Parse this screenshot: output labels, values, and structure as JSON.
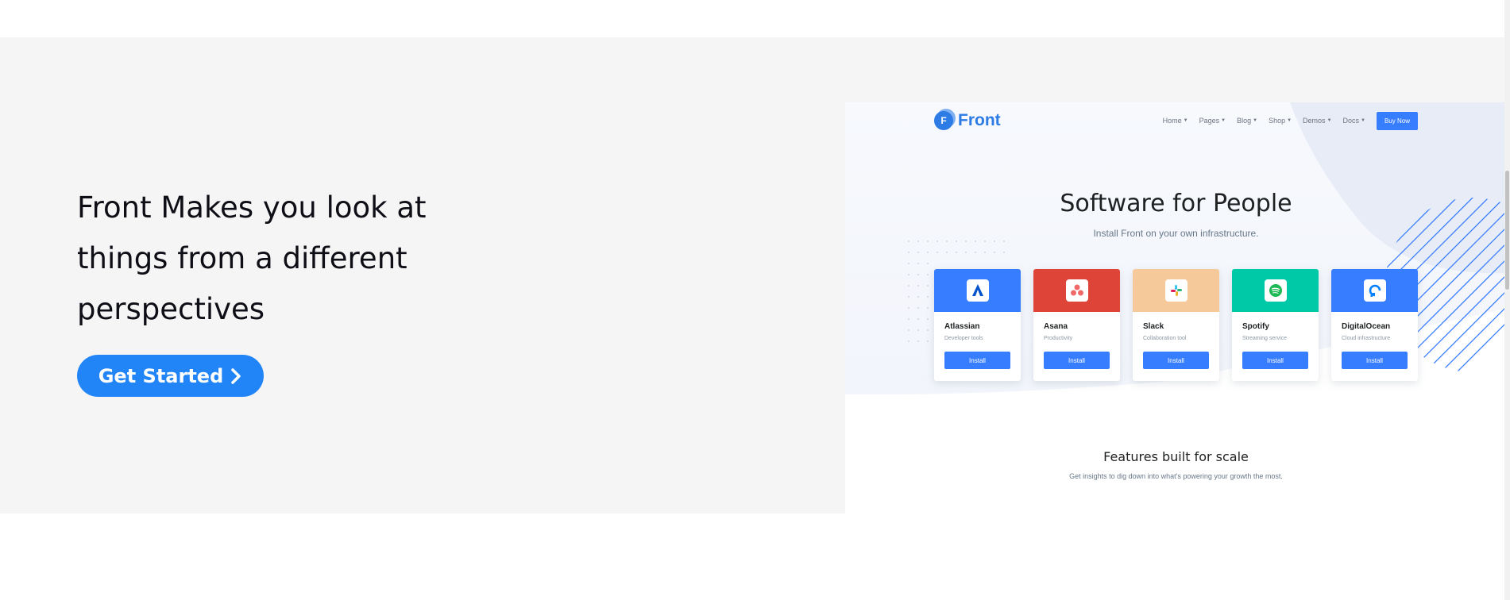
{
  "hero": {
    "title": "Front Makes you look at things from a different perspectives",
    "cta_label": "Get Started"
  },
  "preview": {
    "logo_text": "Front",
    "logo_letter": "F",
    "nav": [
      "Home",
      "Pages",
      "Blog",
      "Shop",
      "Demos",
      "Docs"
    ],
    "buy_label": "Buy Now",
    "title": "Software for People",
    "subtitle": "Install Front on your own infrastructure.",
    "cards": [
      {
        "name": "Atlassian",
        "category": "Developer tools",
        "button": "Install",
        "color": "#377dff",
        "icon": "atlassian-icon"
      },
      {
        "name": "Asana",
        "category": "Productivity",
        "button": "Install",
        "color": "#de4437",
        "icon": "asana-icon"
      },
      {
        "name": "Slack",
        "category": "Collaboration tool",
        "button": "Install",
        "color": "#f6c99a",
        "icon": "slack-icon"
      },
      {
        "name": "Spotify",
        "category": "Streaming service",
        "button": "Install",
        "color": "#00c9a7",
        "icon": "spotify-icon"
      },
      {
        "name": "DigitalOcean",
        "category": "Cloud infrastructure",
        "button": "Install",
        "color": "#377dff",
        "icon": "digitalocean-icon"
      }
    ],
    "features_title": "Features built for scale",
    "features_subtitle": "Get insights to dig down into what's powering your growth the most."
  },
  "colors": {
    "hero_bg": "#f5f5f5",
    "cta": "#2185f7",
    "preview_primary": "#377dff"
  }
}
